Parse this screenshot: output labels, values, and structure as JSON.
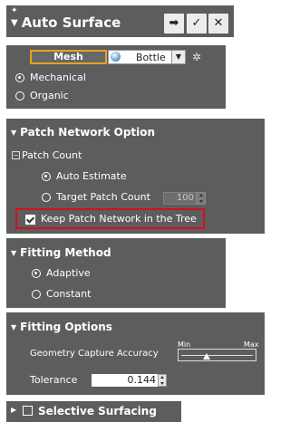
{
  "header": {
    "title": "Auto Surface",
    "buttons": {
      "next": "➡",
      "ok": "✓",
      "cancel": "✕"
    }
  },
  "input_type": {
    "mesh_button": "Mesh",
    "object_selector": "Bottle",
    "mode_options": [
      "Mechanical",
      "Organic"
    ],
    "selected_mode": "Mechanical"
  },
  "patch_network": {
    "title": "Patch Network Option",
    "group_label": "Patch Count",
    "options": [
      "Auto Estimate",
      "Target Patch Count"
    ],
    "selected": "Auto Estimate",
    "target_value": "100",
    "keep_checkbox_label": "Keep Patch Network in the Tree",
    "keep_checked": true
  },
  "fitting_method": {
    "title": "Fitting Method",
    "options": [
      "Adaptive",
      "Constant"
    ],
    "selected": "Adaptive"
  },
  "fitting_options": {
    "title": "Fitting Options",
    "accuracy_label": "Geometry Capture Accuracy",
    "slider_min": "Min",
    "slider_max": "Max",
    "accuracy_level": 0.3,
    "tolerance_label": "Tolerance",
    "tolerance_value": "0.144"
  },
  "selective_surfacing": {
    "title": "Selective Surfacing",
    "checked": false
  },
  "colors": {
    "panel": "#5d5d5d",
    "mesh_highlight": "#e8a21c",
    "checkbox_highlight": "#d0121b"
  }
}
